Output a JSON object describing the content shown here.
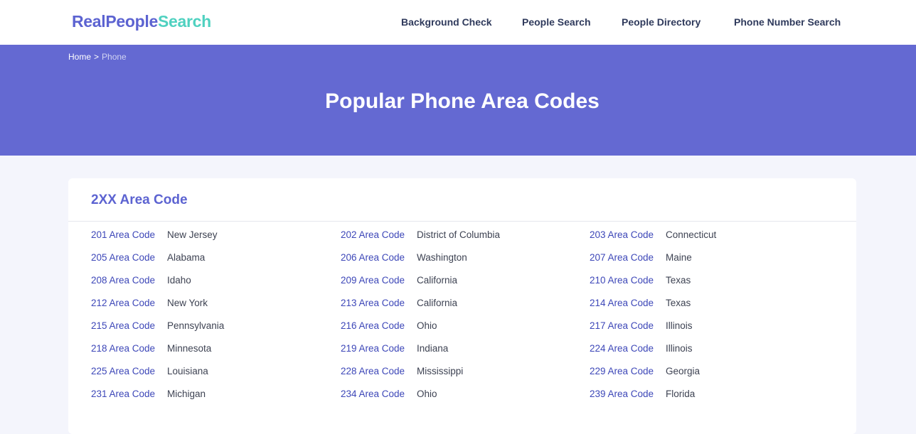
{
  "header": {
    "logo_part1": "RealPeople",
    "logo_part2": "Search",
    "nav": [
      "Background Check",
      "People Search",
      "People Directory",
      "Phone Number Search"
    ]
  },
  "breadcrumb": {
    "home": "Home",
    "separator": ">",
    "current": "Phone"
  },
  "hero": {
    "title": "Popular Phone Area Codes"
  },
  "section": {
    "title": "2XX Area Code",
    "rows": [
      [
        {
          "code": "201 Area Code",
          "state": "New Jersey"
        },
        {
          "code": "202 Area Code",
          "state": "District of Columbia"
        },
        {
          "code": "203 Area Code",
          "state": "Connecticut"
        }
      ],
      [
        {
          "code": "205 Area Code",
          "state": "Alabama"
        },
        {
          "code": "206 Area Code",
          "state": "Washington"
        },
        {
          "code": "207 Area Code",
          "state": "Maine"
        }
      ],
      [
        {
          "code": "208 Area Code",
          "state": "Idaho"
        },
        {
          "code": "209 Area Code",
          "state": "California"
        },
        {
          "code": "210 Area Code",
          "state": "Texas"
        }
      ],
      [
        {
          "code": "212 Area Code",
          "state": "New York"
        },
        {
          "code": "213 Area Code",
          "state": "California"
        },
        {
          "code": "214 Area Code",
          "state": "Texas"
        }
      ],
      [
        {
          "code": "215 Area Code",
          "state": "Pennsylvania"
        },
        {
          "code": "216 Area Code",
          "state": "Ohio"
        },
        {
          "code": "217 Area Code",
          "state": "Illinois"
        }
      ],
      [
        {
          "code": "218 Area Code",
          "state": "Minnesota"
        },
        {
          "code": "219 Area Code",
          "state": "Indiana"
        },
        {
          "code": "224 Area Code",
          "state": "Illinois"
        }
      ],
      [
        {
          "code": "225 Area Code",
          "state": "Louisiana"
        },
        {
          "code": "228 Area Code",
          "state": "Mississippi"
        },
        {
          "code": "229 Area Code",
          "state": "Georgia"
        }
      ],
      [
        {
          "code": "231 Area Code",
          "state": "Michigan"
        },
        {
          "code": "234 Area Code",
          "state": "Ohio"
        },
        {
          "code": "239 Area Code",
          "state": "Florida"
        }
      ]
    ]
  },
  "colors": {
    "brand": "#5c63d1",
    "brand_accent": "#4fd1c0",
    "hero_bg": "#6469d2",
    "link": "#3d47b8"
  }
}
